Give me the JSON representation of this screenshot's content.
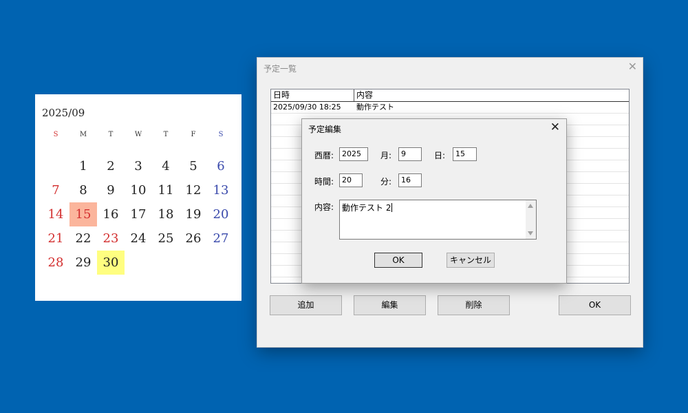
{
  "calendar": {
    "title": "2025/09",
    "weekdays": [
      "S",
      "M",
      "T",
      "W",
      "T",
      "F",
      "S"
    ],
    "weeks": [
      [
        "",
        "1",
        "2",
        "3",
        "4",
        "5",
        "6"
      ],
      [
        "7",
        "8",
        "9",
        "10",
        "11",
        "12",
        "13"
      ],
      [
        "14",
        "15",
        "16",
        "17",
        "18",
        "19",
        "20"
      ],
      [
        "21",
        "22",
        "23",
        "24",
        "25",
        "26",
        "27"
      ],
      [
        "28",
        "29",
        "30",
        "",
        "",
        "",
        ""
      ]
    ],
    "holiday_days": [
      "15",
      "23"
    ],
    "highlighted_today": "15",
    "highlighted_event": "30",
    "colors": {
      "sunday": "#d32f2f",
      "saturday": "#3949ab",
      "today_bg": "#fbb59c",
      "event_bg": "#fffe80"
    }
  },
  "main_window": {
    "title": "予定一覧",
    "close_icon": "close-icon",
    "list": {
      "columns": [
        "日時",
        "内容"
      ],
      "rows": [
        {
          "datetime": "2025/09/30 18:25",
          "content": "動作テスト"
        }
      ]
    },
    "buttons": {
      "add": "追加",
      "edit": "編集",
      "delete": "削除",
      "ok": "OK"
    }
  },
  "edit_dialog": {
    "title": "予定編集",
    "close_icon": "close-icon",
    "labels": {
      "year": "西暦:",
      "month": "月:",
      "day": "日:",
      "hour": "時間:",
      "minute": "分:",
      "content": "内容:"
    },
    "values": {
      "year": "2025",
      "month": "9",
      "day": "15",
      "hour": "20",
      "minute": "16",
      "content": "動作テスト 2"
    },
    "buttons": {
      "ok": "OK",
      "cancel": "キャンセル"
    }
  }
}
